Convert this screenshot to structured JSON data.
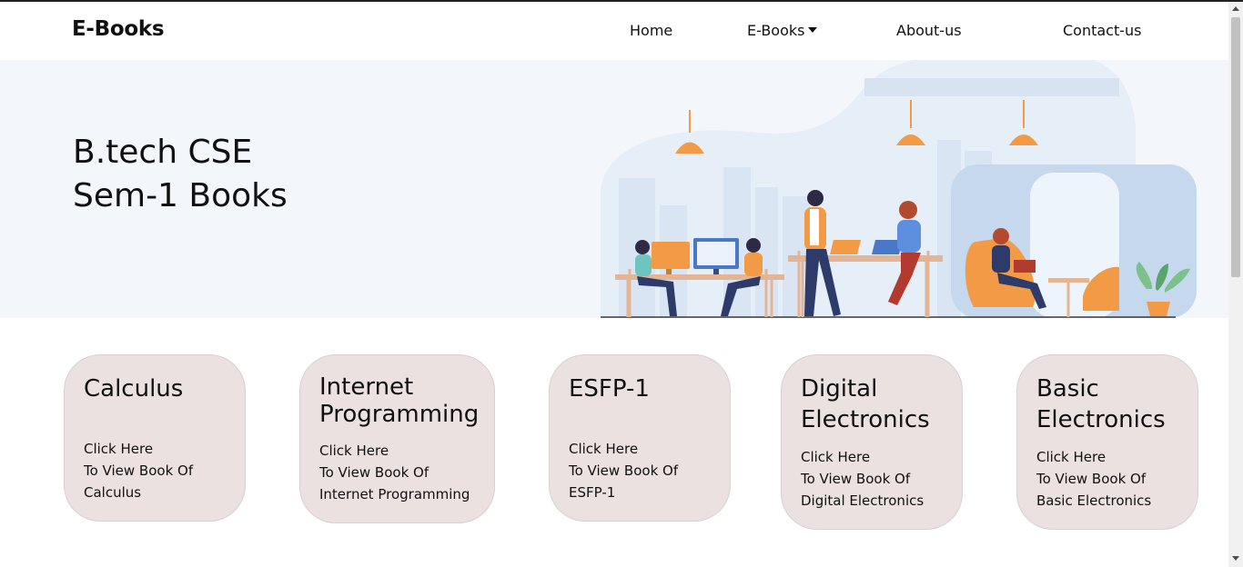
{
  "navbar": {
    "brand": "E-Books",
    "links": [
      {
        "label": "Home"
      },
      {
        "label": "E-Books",
        "has_dropdown": true
      },
      {
        "label": "About-us"
      },
      {
        "label": "Contact-us"
      }
    ]
  },
  "hero": {
    "title_line1": "B.tech CSE",
    "title_line2": "Sem-1 Books",
    "illustration": "office-coworking-illustration"
  },
  "cards": [
    {
      "title": "Calculus",
      "line1": "Click Here",
      "line2": "To View Book Of",
      "line3": "Calculus"
    },
    {
      "title_line1": "Internet",
      "title_line2": "Programming",
      "line1": "Click Here",
      "line2": "To View Book Of",
      "line3": "Internet Programming"
    },
    {
      "title": "ESFP-1",
      "line1": "Click Here",
      "line2": "To View Book Of",
      "line3": "ESFP-1"
    },
    {
      "title_line1": "Digital",
      "title_line2": "Electronics",
      "line1": "Click Here",
      "line2": "To View Book Of",
      "line3": "Digital Electronics"
    },
    {
      "title_line1": "Basic",
      "title_line2": "Electronics",
      "line1": "Click Here",
      "line2": "To View Book Of",
      "line3": "Basic Electronics"
    }
  ],
  "colors": {
    "hero_bg": "#f3f6fa",
    "card_bg": "#ebe1e0",
    "accent_orange": "#f39a47",
    "accent_blue": "#4a78c8"
  }
}
